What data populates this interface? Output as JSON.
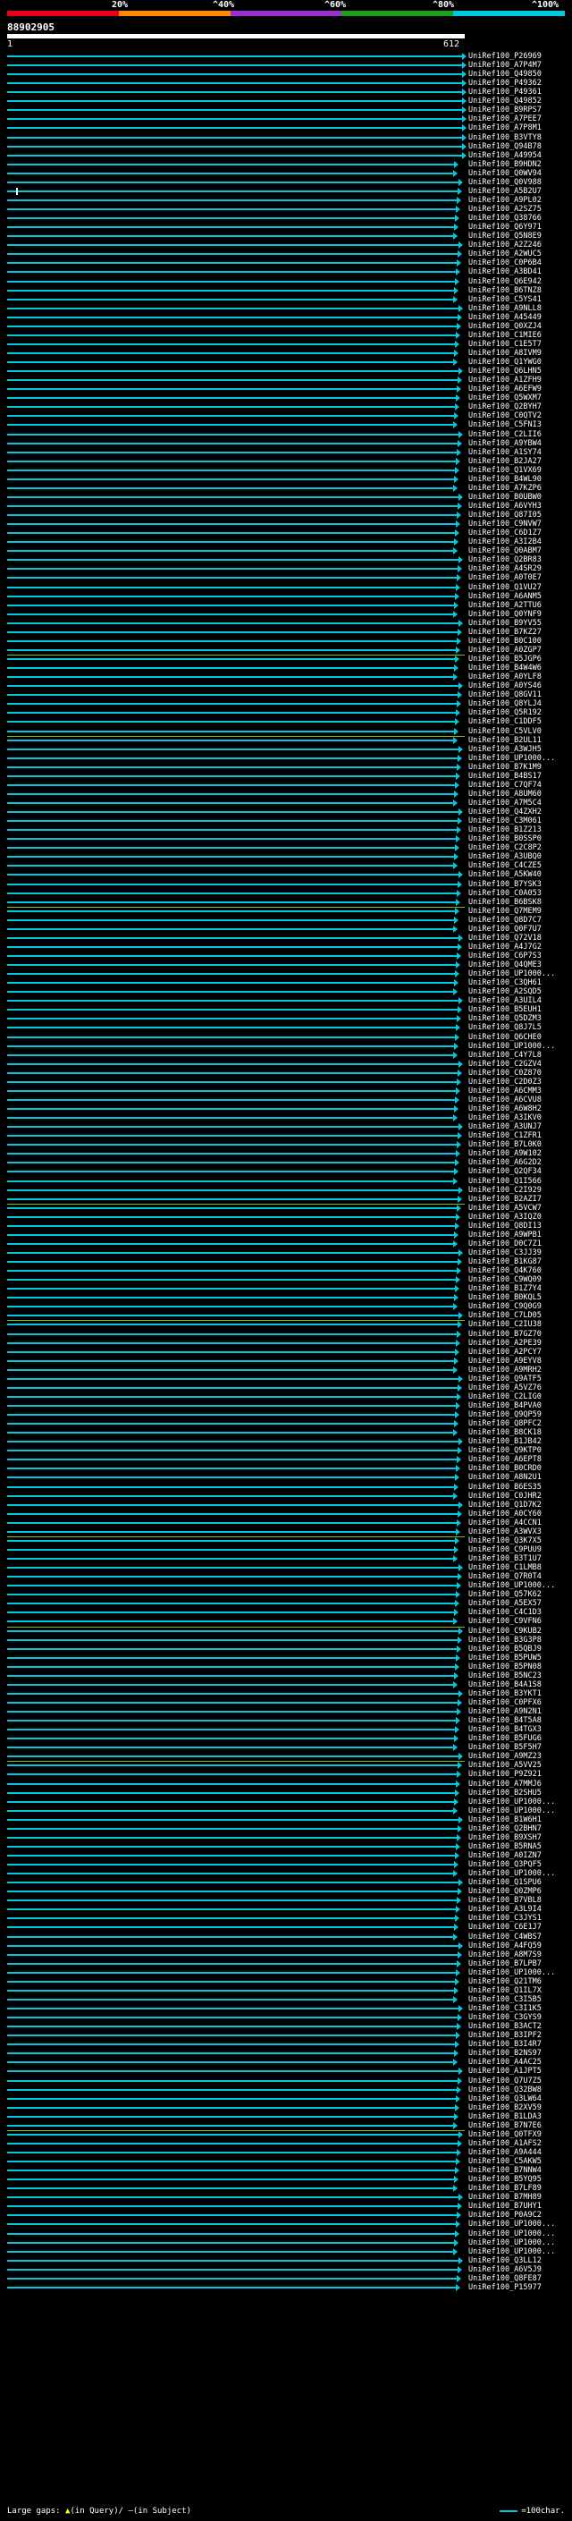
{
  "scale": {
    "percent_labels": [
      "20%",
      "^40%",
      "^60%",
      "^80%",
      "^100%"
    ],
    "segment_colors": [
      "#e8001c",
      "#ff8c00",
      "#9b30d0",
      "#1ea01e",
      "#00c8e0"
    ]
  },
  "query": {
    "name": "88902905",
    "range_start": "1",
    "range_end": "612"
  },
  "colors": {
    "hit": "#00c8e0",
    "highlight": "#7fbf00",
    "gap": "#ffffff"
  },
  "hits": [
    "UniRef100_P26969",
    "UniRef100_A7P4M7",
    "UniRef100_Q49850",
    "UniRef100_P49362",
    "UniRef100_P49361",
    "UniRef100_Q49852",
    "UniRef100_B9RPS7",
    "UniRef100_A7PEE7",
    "UniRef100_A7P8M1",
    "UniRef100_B3VTY8",
    "UniRef100_Q94B78",
    "UniRef100_A49954",
    "UniRef100_B9HDN2",
    "UniRef100_Q0WV94",
    "UniRef100_Q0V988",
    "UniRef100_A5B2U7",
    "UniRef100_A9PL02",
    "UniRef100_A2SZ75",
    "UniRef100_Q38766",
    "UniRef100_Q6Y971",
    "UniRef100_Q5N8E9",
    "UniRef100_A2Z246",
    "UniRef100_A2WUC5",
    "UniRef100_C0P6B4",
    "UniRef100_A3BD41",
    "UniRef100_Q6E942",
    "UniRef100_B6TNZ8",
    "UniRef100_C5YS41",
    "UniRef100_A9NLL8",
    "UniRef100_A45449",
    "UniRef100_Q0XZJ4",
    "UniRef100_C1MIE6",
    "UniRef100_C1E5T7",
    "UniRef100_A8IVM9",
    "UniRef100_Q1YWG0",
    "UniRef100_Q6LHN5",
    "UniRef100_A1ZFH9",
    "UniRef100_A6EFW9",
    "UniRef100_Q5WXM7",
    "UniRef100_Q2BYH7",
    "UniRef100_C0QTV2",
    "UniRef100_C5FNI3",
    "UniRef100_C2LII6",
    "UniRef100_A9YBW4",
    "UniRef100_A1SY74",
    "UniRef100_B2JA27",
    "UniRef100_Q1VX69",
    "UniRef100_B4WL90",
    "UniRef100_A7KZP6",
    "UniRef100_B0UBW0",
    "UniRef100_A6VYH3",
    "UniRef100_Q87I05",
    "UniRef100_C9NVW7",
    "UniRef100_C6D1Z7",
    "UniRef100_A3I2B4",
    "UniRef100_Q0ABM7",
    "UniRef100_Q2BR83",
    "UniRef100_A4SR29",
    "UniRef100_A0T0E7",
    "UniRef100_Q1VU27",
    "UniRef100_A6ANM5",
    "UniRef100_A2TTU6",
    "UniRef100_Q0YNF9",
    "UniRef100_B9YV55",
    "UniRef100_B7KZ27",
    "UniRef100_B0C100",
    "UniRef100_A0ZGP7",
    "UniRef100_B5JGP6",
    "UniRef100_B4W4W6",
    "UniRef100_A0YLF8",
    "UniRef100_A0YS46",
    "UniRef100_Q8GV11",
    "UniRef100_Q8YLJ4",
    "UniRef100_Q5R192",
    "UniRef100_C1DDF5",
    "UniRef100_C5VLV0",
    "UniRef100_B2UL11",
    "UniRef100_A3WJH5",
    "UniRef100_UP1000...",
    "UniRef100_B7K1M9",
    "UniRef100_B4BS17",
    "UniRef100_C7QF74",
    "UniRef100_A8UM60",
    "UniRef100_A7M5C4",
    "UniRef100_Q4ZXH2",
    "UniRef100_C3M061",
    "UniRef100_B1Z213",
    "UniRef100_B0SSP0",
    "UniRef100_C2C8P2",
    "UniRef100_A3UBQ0",
    "UniRef100_C4CZE5",
    "UniRef100_A5KW40",
    "UniRef100_B7YSK3",
    "UniRef100_C0A053",
    "UniRef100_B6BSK8",
    "UniRef100_Q7MEM9",
    "UniRef100_Q8D7C7",
    "UniRef100_Q0F7U7",
    "UniRef100_Q72V18",
    "UniRef100_A4J7G2",
    "UniRef100_C6P7S3",
    "UniRef100_Q4QME3",
    "UniRef100_UP1000...",
    "UniRef100_C3QH61",
    "UniRef100_A2SQD5",
    "UniRef100_A3UIL4",
    "UniRef100_B5EUH1",
    "UniRef100_Q5DZM3",
    "UniRef100_Q8J7L5",
    "UniRef100_Q6CHE0",
    "UniRef100_UP1000...",
    "UniRef100_C4Y7L8",
    "UniRef100_C2GZV4",
    "UniRef100_C0Z870",
    "UniRef100_C2D0Z3",
    "UniRef100_A6CMM3",
    "UniRef100_A6CVU8",
    "UniRef100_A6W8H2",
    "UniRef100_A3IKV0",
    "UniRef100_A3UNJ7",
    "UniRef100_C1ZFR1",
    "UniRef100_B7L0K0",
    "UniRef100_A9W102",
    "UniRef100_A6G2D2",
    "UniRef100_Q2QF34",
    "UniRef100_Q1I566",
    "UniRef100_C2I929",
    "UniRef100_B2AZI7",
    "UniRef100_A5VCW7",
    "UniRef100_A3IQZ0",
    "UniRef100_Q8DI13",
    "UniRef100_A9WPB1",
    "UniRef100_D0C7Z1",
    "UniRef100_C3JJ39",
    "UniRef100_B1KG87",
    "UniRef100_Q4K760",
    "UniRef100_C9WQ09",
    "UniRef100_B1Z7Y4",
    "UniRef100_B0KQL5",
    "UniRef100_C9Q0G9",
    "UniRef100_C7LD05",
    "UniRef100_C2IU38",
    "UniRef100_B7GZ70",
    "UniRef100_A2PE39",
    "UniRef100_A2PCY7",
    "UniRef100_A9EYV8",
    "UniRef100_A9MRH2",
    "UniRef100_Q9ATF5",
    "UniRef100_A5VZ76",
    "UniRef100_C2LIG0",
    "UniRef100_B4PVA0",
    "UniRef100_Q9QP59",
    "UniRef100_Q8PFC2",
    "UniRef100_B8CK18",
    "UniRef100_B1JB42",
    "UniRef100_Q9KTP0",
    "UniRef100_A6EPT8",
    "UniRef100_B0CRD0",
    "UniRef100_A8N2U1",
    "UniRef100_B6ES35",
    "UniRef100_C0JHR2",
    "UniRef100_Q1D7K2",
    "UniRef100_A0CY60",
    "UniRef100_A4CCN1",
    "UniRef100_A3WVX3",
    "UniRef100_Q3K7X5",
    "UniRef100_C9PUU9",
    "UniRef100_B3T1U7",
    "UniRef100_C1LMB8",
    "UniRef100_Q7R0T4",
    "UniRef100_UP1000...",
    "UniRef100_Q57K62",
    "UniRef100_A5EX57",
    "UniRef100_C4C1D3",
    "UniRef100_C9VFN6",
    "UniRef100_C9KUB2",
    "UniRef100_B3G3P8",
    "UniRef100_B5QBJ9",
    "UniRef100_B5PUW5",
    "UniRef100_B5PN08",
    "UniRef100_B5NC23",
    "UniRef100_B4A1S8",
    "UniRef100_B3YKT1",
    "UniRef100_C0PFX6",
    "UniRef100_A9N2N1",
    "UniRef100_B4T5A8",
    "UniRef100_B4TGX3",
    "UniRef100_B5FUG6",
    "UniRef100_B5F5H7",
    "UniRef100_A9MZ23",
    "UniRef100_A5VV25",
    "UniRef100_P9Z921",
    "UniRef100_A7MMJ6",
    "UniRef100_B2SHU5",
    "UniRef100_UP1000...",
    "UniRef100_UP1000...",
    "UniRef100_B1W6H1",
    "UniRef100_Q2BHN7",
    "UniRef100_B9XSH7",
    "UniRef100_B5RNA5",
    "UniRef100_A0IZN7",
    "UniRef100_Q3PQF5",
    "UniRef100_UP1000...",
    "UniRef100_Q1SPU6",
    "UniRef100_Q0ZMP6",
    "UniRef100_B7VBL8",
    "UniRef100_A3L9I4",
    "UniRef100_C3JYS1",
    "UniRef100_C6E1J7",
    "UniRef100_C4WBS7",
    "UniRef100_A4FQ59",
    "UniRef100_A8M7S9",
    "UniRef100_B7LPB7",
    "UniRef100_UP1000...",
    "UniRef100_Q21TM6",
    "UniRef100_Q1IL7X",
    "UniRef100_C3I5B5",
    "UniRef100_C3I1K5",
    "UniRef100_C3GYS9",
    "UniRef100_B3ACT2",
    "UniRef100_B3IPF2",
    "UniRef100_B3I4R7",
    "UniRef100_B2NS97",
    "UniRef100_A4AC25",
    "UniRef100_A1JPT5",
    "UniRef100_Q7U7Z5",
    "UniRef100_Q32BW8",
    "UniRef100_Q3LW64",
    "UniRef100_B2XV59",
    "UniRef100_B1LDA3",
    "UniRef100_B7N7E6",
    "UniRef100_Q0TFX9",
    "UniRef100_A1AFS2",
    "UniRef100_A9A444",
    "UniRef100_C5AKW5",
    "UniRef100_B7NNW4",
    "UniRef100_B5YQ95",
    "UniRef100_B7LF89",
    "UniRef100_B7MH89",
    "UniRef100_B7UHY1",
    "UniRef100_P0A9C2",
    "UniRef100_UP1000...",
    "UniRef100_UP1000...",
    "UniRef100_UP1000...",
    "UniRef100_UP1000...",
    "UniRef100_Q3LL12",
    "UniRef100_A6V5J9",
    "UniRef100_Q8FE87",
    "UniRef100_P15977"
  ],
  "footer": {
    "gaps_label": "Large gaps:",
    "gap_up": "▲",
    "gap_up_desc": "(in Query)/",
    "gap_down": "–",
    "gap_down_desc": "(in Subject)",
    "scale_label": "=100char."
  }
}
